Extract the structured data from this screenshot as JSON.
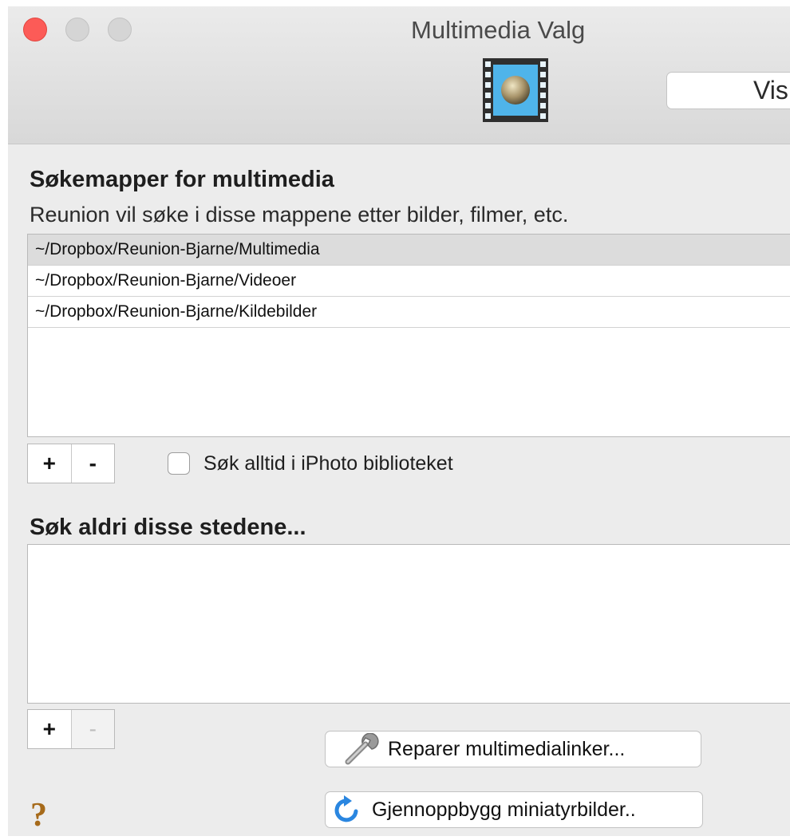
{
  "window": {
    "title": "Multimedia Valg",
    "toolbar_button_label": "Vis"
  },
  "search_folders": {
    "title": "Søkemapper for multimedia",
    "subtitle": "Reunion vil søke i disse mappene etter bilder, filmer, etc.",
    "items": [
      {
        "path": "~/Dropbox/Reunion-Bjarne/Multimedia",
        "selected": true
      },
      {
        "path": "~/Dropbox/Reunion-Bjarne/Videoer",
        "selected": false
      },
      {
        "path": "~/Dropbox/Reunion-Bjarne/Kildebilder",
        "selected": false
      }
    ],
    "add_label": "+",
    "remove_label": "-",
    "iphoto_checkbox_label": "Søk alltid i iPhoto biblioteket",
    "iphoto_checked": false
  },
  "never_search": {
    "title": "Søk aldri disse stedene...",
    "items": [],
    "add_label": "+",
    "remove_label": "-",
    "remove_disabled": true
  },
  "actions": {
    "repair_label": "Reparer multimedialinker...",
    "rebuild_label": "Gjennoppbygg miniatyrbilder.."
  },
  "help_label": "?",
  "colors": {
    "close_button": "#fc5b57",
    "help_icon": "#a66a1a",
    "rebuild_icon": "#2a86e0"
  },
  "icons": {
    "toolbar": "film-icon",
    "repair": "wrench-icon",
    "rebuild": "refresh-icon"
  }
}
